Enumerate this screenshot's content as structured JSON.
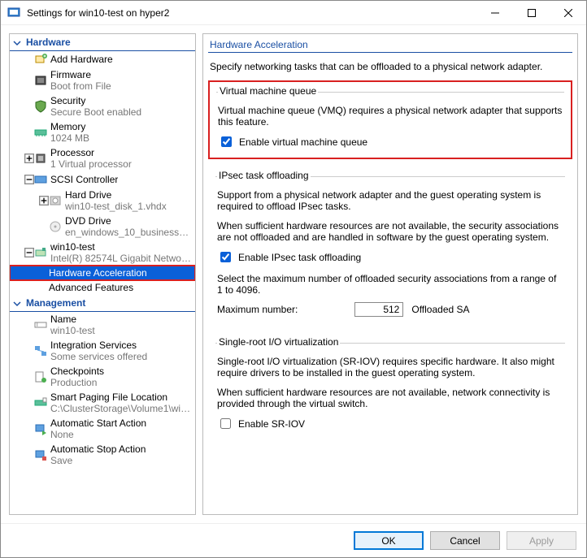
{
  "window": {
    "title": "Settings for win10-test on hyper2"
  },
  "tree": {
    "hardware": "Hardware",
    "addHardware": "Add Hardware",
    "firmware": {
      "label": "Firmware",
      "sub": "Boot from File"
    },
    "security": {
      "label": "Security",
      "sub": "Secure Boot enabled"
    },
    "memory": {
      "label": "Memory",
      "sub": "1024 MB"
    },
    "processor": {
      "label": "Processor",
      "sub": "1 Virtual processor"
    },
    "scsi": {
      "label": "SCSI Controller"
    },
    "hdd": {
      "label": "Hard Drive",
      "sub": "win10-test_disk_1.vhdx"
    },
    "dvd": {
      "label": "DVD Drive",
      "sub": "en_windows_10_business_editi..."
    },
    "nic": {
      "label": "win10-test",
      "sub": "Intel(R) 82574L Gigabit Network C..."
    },
    "hwaccel": "Hardware Acceleration",
    "advfeat": "Advanced Features",
    "management": "Management",
    "name": {
      "label": "Name",
      "sub": "win10-test"
    },
    "integ": {
      "label": "Integration Services",
      "sub": "Some services offered"
    },
    "check": {
      "label": "Checkpoints",
      "sub": "Production"
    },
    "paging": {
      "label": "Smart Paging File Location",
      "sub": "C:\\ClusterStorage\\Volume1\\win10-..."
    },
    "autostart": {
      "label": "Automatic Start Action",
      "sub": "None"
    },
    "autostop": {
      "label": "Automatic Stop Action",
      "sub": "Save"
    }
  },
  "right": {
    "title": "Hardware Acceleration",
    "desc": "Specify networking tasks that can be offloaded to a physical network adapter.",
    "vmq": {
      "title": "Virtual machine queue",
      "desc": "Virtual machine queue (VMQ) requires a physical network adapter that supports this feature.",
      "cb": "Enable virtual machine queue"
    },
    "ipsec": {
      "title": "IPsec task offloading",
      "desc1": "Support from a physical network adapter and the guest operating system is required to offload IPsec tasks.",
      "desc2": "When sufficient hardware resources are not available, the security associations are not offloaded and are handled in software by the guest operating system.",
      "cb": "Enable IPsec task offloading",
      "select": "Select the maximum number of offloaded security associations from a range of 1 to 4096.",
      "maxlabel": "Maximum number:",
      "maxval": "512",
      "suffix": "Offloaded SA"
    },
    "sriov": {
      "title": "Single-root I/O virtualization",
      "desc1": "Single-root I/O virtualization (SR-IOV) requires specific hardware. It also might require drivers to be installed in the guest operating system.",
      "desc2": "When sufficient hardware resources are not available, network connectivity is provided through the virtual switch.",
      "cb": "Enable SR-IOV"
    }
  },
  "footer": {
    "ok": "OK",
    "cancel": "Cancel",
    "apply": "Apply"
  }
}
